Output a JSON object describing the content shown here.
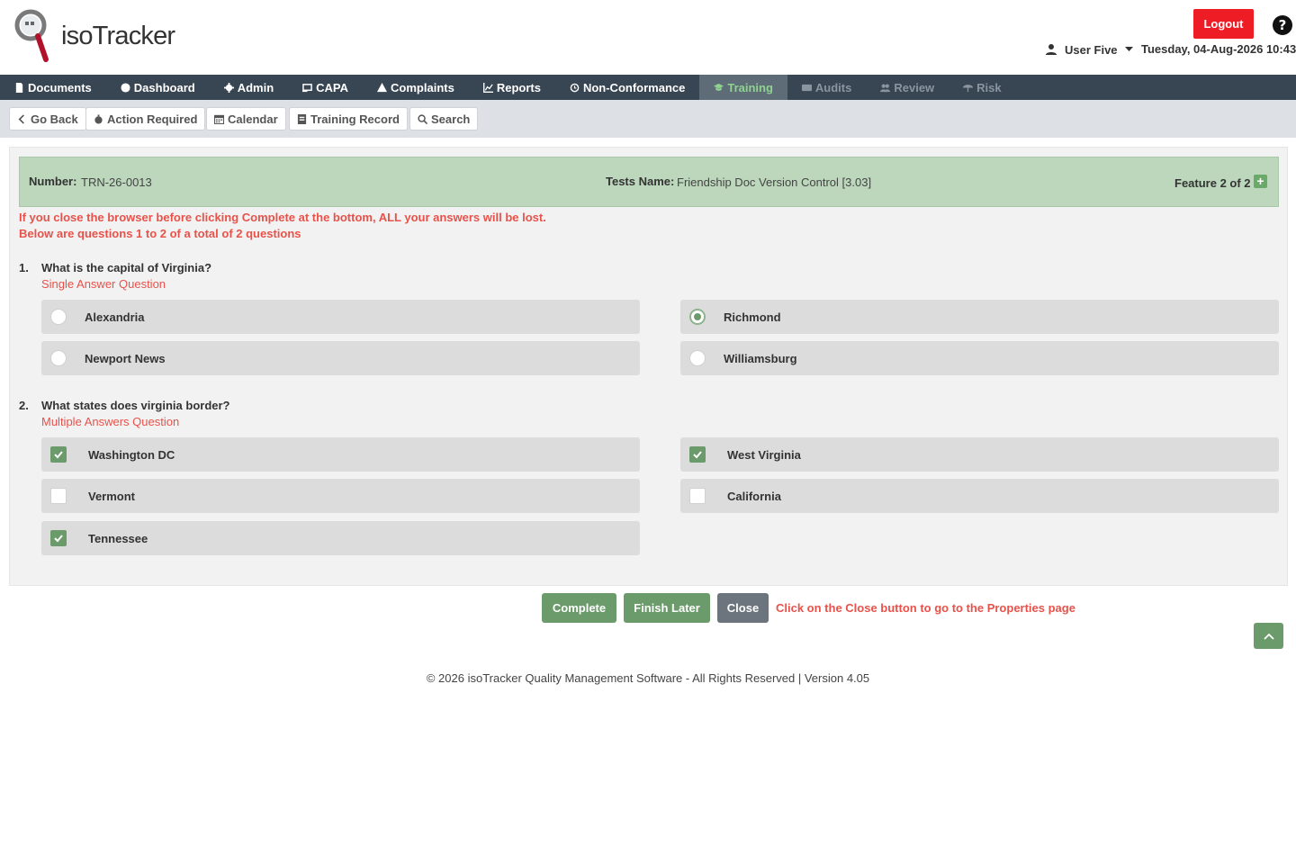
{
  "header": {
    "logo_text": "isoTracker",
    "logout_label": "Logout",
    "user_name": "User Five",
    "datetime": "Tuesday, 04-Aug-2026 10:43"
  },
  "nav": {
    "items": [
      {
        "label": "Documents",
        "icon": "document-icon",
        "state": "normal"
      },
      {
        "label": "Dashboard",
        "icon": "dashboard-icon",
        "state": "normal"
      },
      {
        "label": "Admin",
        "icon": "gear-icon",
        "state": "normal"
      },
      {
        "label": "CAPA",
        "icon": "capa-icon",
        "state": "normal"
      },
      {
        "label": "Complaints",
        "icon": "warning-icon",
        "state": "normal"
      },
      {
        "label": "Reports",
        "icon": "chart-icon",
        "state": "normal"
      },
      {
        "label": "Non-Conformance",
        "icon": "history-icon",
        "state": "normal"
      },
      {
        "label": "Training",
        "icon": "graduation-cap-icon",
        "state": "active"
      },
      {
        "label": "Audits",
        "icon": "id-card-icon",
        "state": "disabled"
      },
      {
        "label": "Review",
        "icon": "users-icon",
        "state": "disabled"
      },
      {
        "label": "Risk",
        "icon": "umbrella-icon",
        "state": "disabled"
      }
    ]
  },
  "subbar": {
    "go_back": "Go Back",
    "action_required": "Action Required",
    "calendar": "Calendar",
    "training_record": "Training Record",
    "search": "Search"
  },
  "info": {
    "number_label": "Number:",
    "number_value": "TRN-26-0013",
    "test_label": "Tests Name:",
    "test_value": "Friendship Doc Version Control [3.03]",
    "feature": "Feature 2 of 2"
  },
  "warnings": {
    "line1": "If you close the browser before clicking Complete at the bottom, ALL your answers will be lost.",
    "line2": "Below are questions 1 to 2 of a total of 2 questions"
  },
  "questions": [
    {
      "num": "1.",
      "title": "What is the capital of Virginia?",
      "type": "Single Answer Question",
      "options": [
        {
          "label": "Alexandria",
          "checked": false
        },
        {
          "label": "Richmond",
          "checked": true
        },
        {
          "label": "Newport News",
          "checked": false
        },
        {
          "label": "Williamsburg",
          "checked": false
        }
      ]
    },
    {
      "num": "2.",
      "title": "What states does virginia border?",
      "type": "Multiple Answers Question",
      "options": [
        {
          "label": "Washington DC",
          "checked": true
        },
        {
          "label": "West Virginia",
          "checked": true
        },
        {
          "label": "Vermont",
          "checked": false
        },
        {
          "label": "California",
          "checked": false
        },
        {
          "label": "Tennessee",
          "checked": true
        }
      ]
    }
  ],
  "actions": {
    "complete": "Complete",
    "finish_later": "Finish Later",
    "close": "Close",
    "note": "Click on the Close button to go to the Properties page"
  },
  "footer": {
    "text": "© 2026 isoTracker Quality Management Software - All Rights Reserved | Version 4.05"
  },
  "colors": {
    "nav_bg": "#384552",
    "accent_green": "#6b9b6b",
    "info_bar": "#bcd7bc",
    "warning_red": "#e8524a",
    "logout_red": "#ee1c25"
  }
}
